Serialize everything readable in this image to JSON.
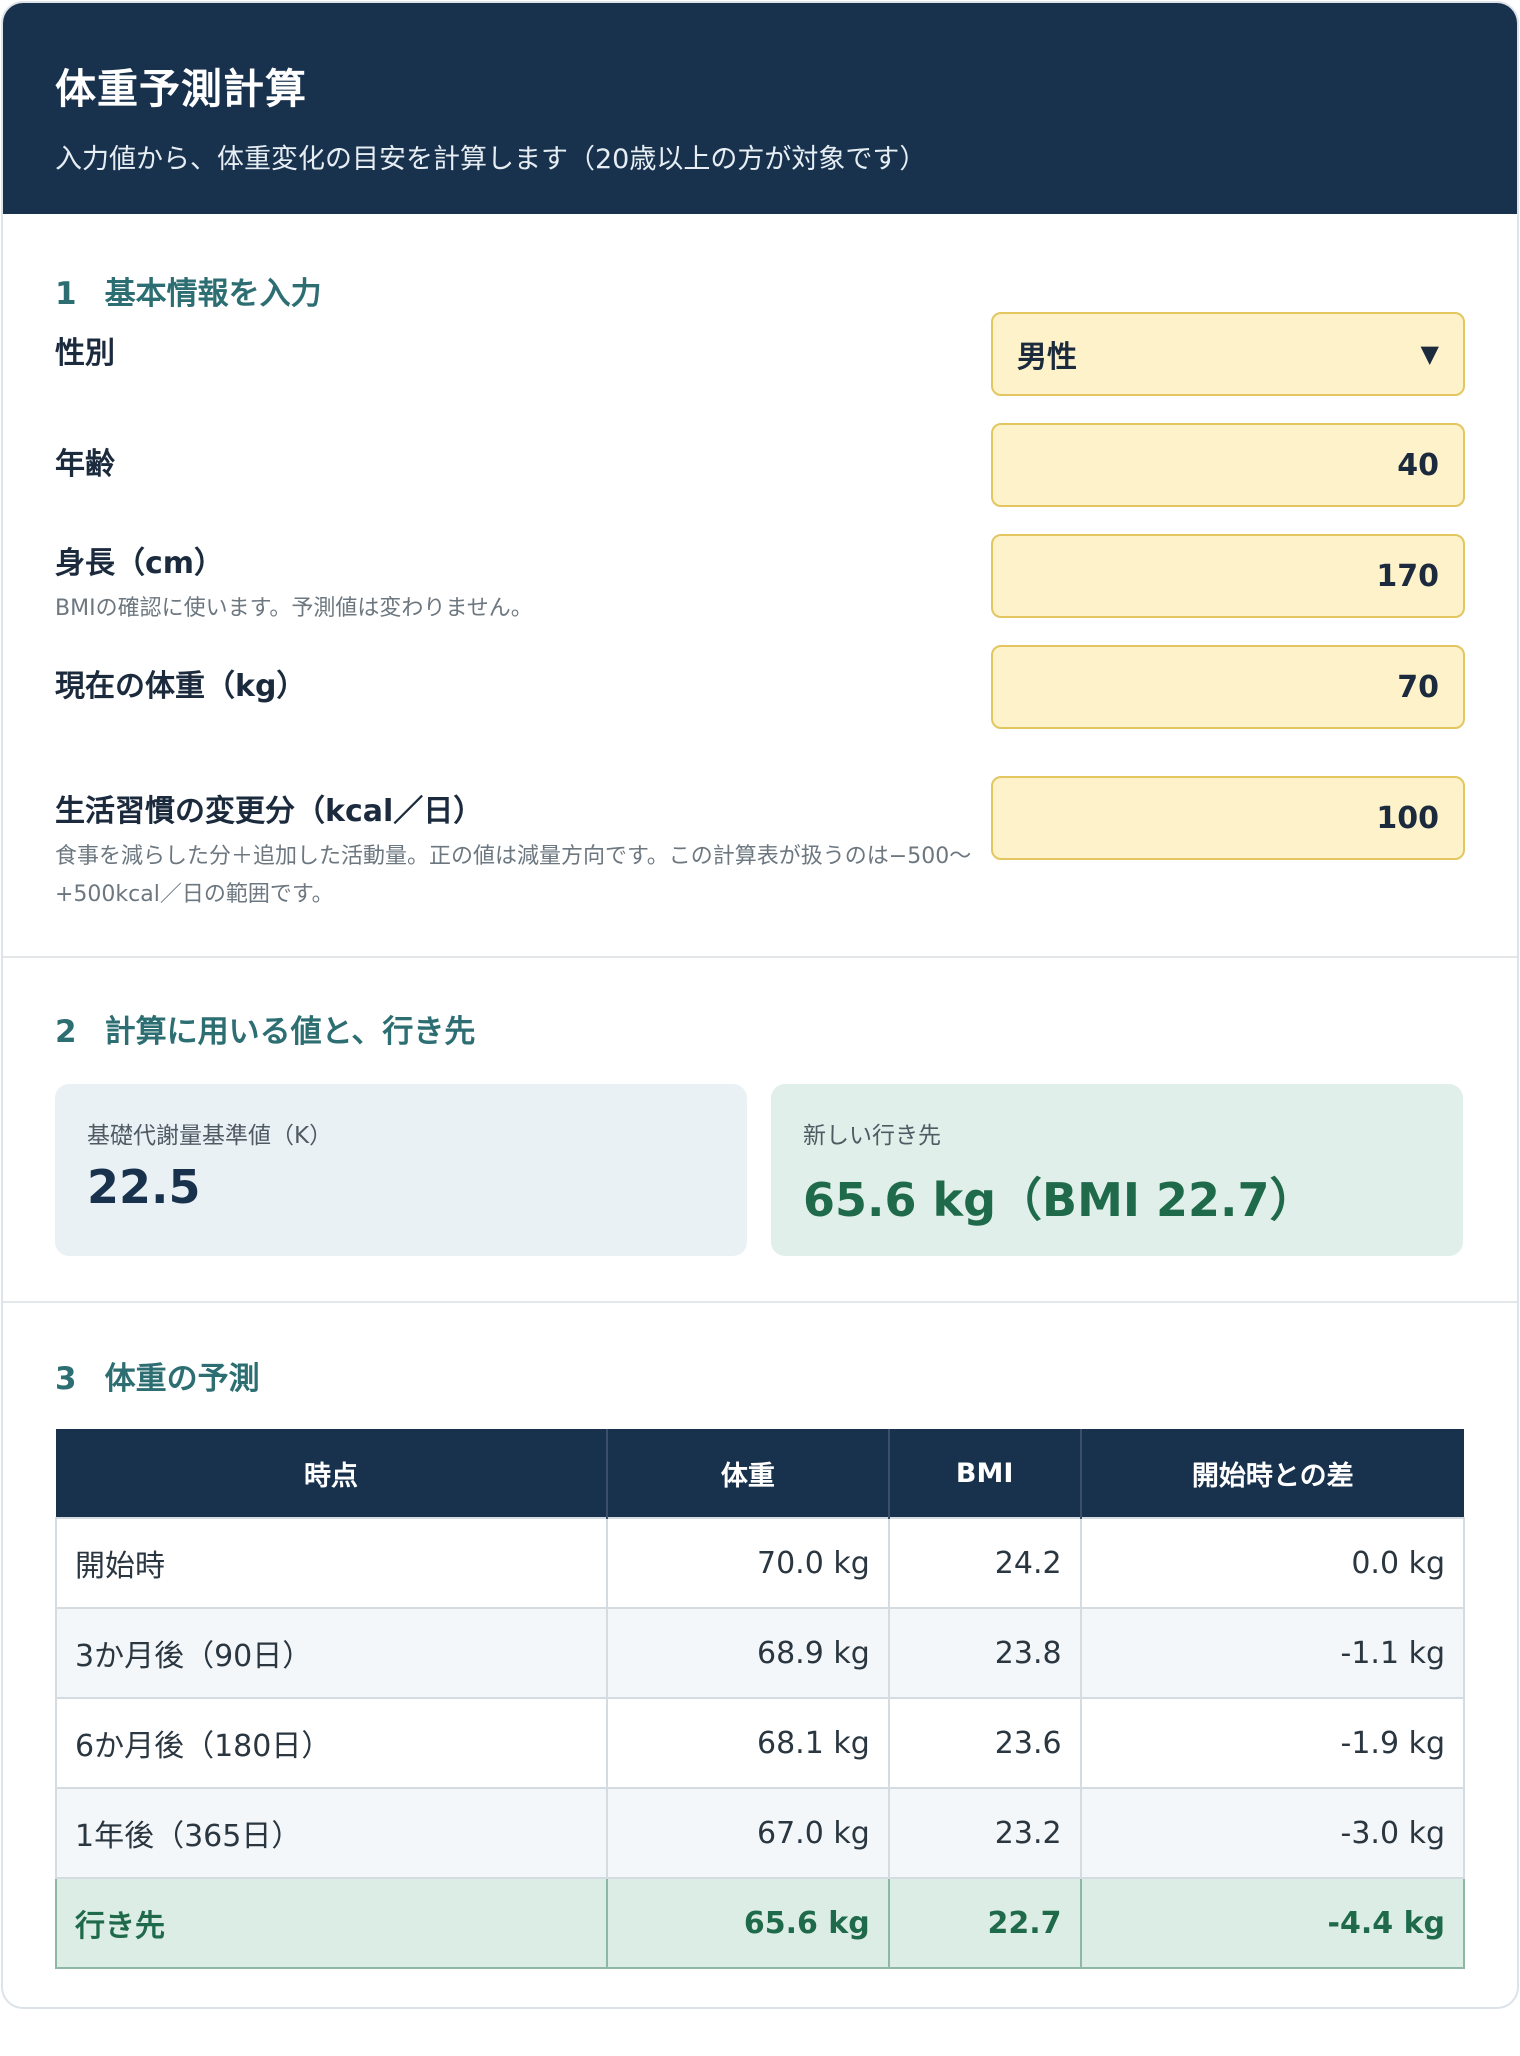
{
  "header": {
    "title": "体重予測計算",
    "subtitle": "入力値から、体重変化の目安を計算します（20歳以上の方が対象です）"
  },
  "section1": {
    "num": "1",
    "title": "基本情報を入力",
    "sex": {
      "label": "性別",
      "value": "男性",
      "caret": "▼"
    },
    "age": {
      "label": "年齢",
      "value": "40"
    },
    "height": {
      "label": "身長（cm）",
      "hint": "BMIの確認に使います。予測値は変わりません。",
      "value": "170"
    },
    "weight": {
      "label": "現在の体重（kg）",
      "value": "70"
    },
    "kcal": {
      "label": "生活習慣の変更分（kcal／日）",
      "hint": "食事を減らした分＋追加した活動量。正の値は減量方向です。この計算表が扱うのは−500〜+500kcal／日の範囲です。",
      "value": "100"
    }
  },
  "section2": {
    "num": "2",
    "title": "計算に用いる値と、行き先",
    "k_caption": "基礎代謝量基準値（K）",
    "k_value": "22.5",
    "dest_caption": "新しい行き先",
    "dest_value": "65.6 kg（BMI 22.7）"
  },
  "section3": {
    "num": "3",
    "title": "体重の予測",
    "headers": [
      "時点",
      "体重",
      "BMI",
      "開始時との差"
    ],
    "rows": [
      [
        "開始時",
        "70.0 kg",
        "24.2",
        "0.0 kg"
      ],
      [
        "3か月後（90日）",
        "68.9 kg",
        "23.8",
        "-1.1 kg"
      ],
      [
        "6か月後（180日）",
        "68.1 kg",
        "23.6",
        "-1.9 kg"
      ],
      [
        "1年後（365日）",
        "67.0 kg",
        "23.2",
        "-3.0 kg"
      ],
      [
        "行き先",
        "65.6 kg",
        "22.7",
        "-4.4 kg"
      ]
    ]
  }
}
